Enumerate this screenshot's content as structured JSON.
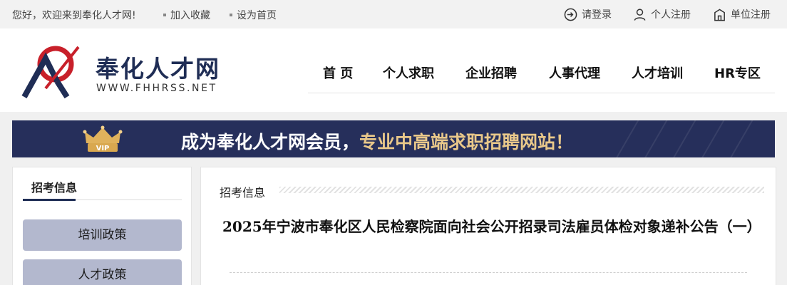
{
  "topbar": {
    "welcome": "您好，欢迎来到奉化人才网!",
    "bookmark": "加入收藏",
    "homepage": "设为首页",
    "login": "请登录",
    "personal_register": "个人注册",
    "company_register": "单位注册"
  },
  "logo": {
    "name": "奉化人才网",
    "url": "WWW.FHHRSS.NET"
  },
  "nav": [
    "首 页",
    "个人求职",
    "企业招聘",
    "人事代理",
    "人才培训",
    "HR专区"
  ],
  "banner": {
    "badge": "VIP",
    "text_main": "成为奉化人才网会员，",
    "text_highlight": "专业中高端求职招聘网站！"
  },
  "sidebar": {
    "title": "招考信息",
    "items": [
      "培训政策",
      "人才政策"
    ]
  },
  "main": {
    "section_title": "招考信息",
    "article_title": "2025年宁波市奉化区人民检察院面向社会公开招录司法雇员体检对象递补公告（一）"
  },
  "colors": {
    "brand_navy": "#1f2d55",
    "brand_red": "#c8202a",
    "banner_bg": "#262f5b",
    "banner_highlight": "#e9c88a",
    "sidebar_button": "#b3b8ce"
  }
}
